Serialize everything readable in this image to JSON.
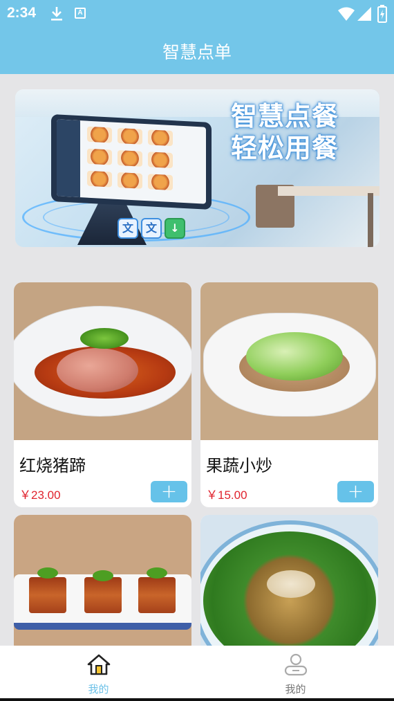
{
  "status_bar": {
    "time": "2:34",
    "a_badge": "A",
    "icons": [
      "download-icon",
      "a-badge-icon",
      "wifi-icon",
      "signal-icon",
      "battery-icon"
    ]
  },
  "app_bar": {
    "title": "智慧点单"
  },
  "banner": {
    "line1": "智慧点餐",
    "line2": "轻松用餐",
    "tiles": [
      "文",
      "文"
    ]
  },
  "dishes": [
    {
      "name": "红烧猪蹄",
      "price": "￥23.00"
    },
    {
      "name": "果蔬小炒",
      "price": "￥15.00"
    },
    {
      "name": "",
      "price": ""
    },
    {
      "name": "",
      "price": ""
    }
  ],
  "add_label": "+",
  "nav": [
    {
      "label": "我的",
      "icon": "home-icon",
      "active": true
    },
    {
      "label": "我的",
      "icon": "user-icon",
      "active": false
    }
  ],
  "colors": {
    "primary": "#73c6e9",
    "price": "#e0232e",
    "add_button": "#66c2e9",
    "nav_active": "#6cc1e8",
    "nav_inactive": "#777777",
    "background": "#e5e5e7"
  }
}
